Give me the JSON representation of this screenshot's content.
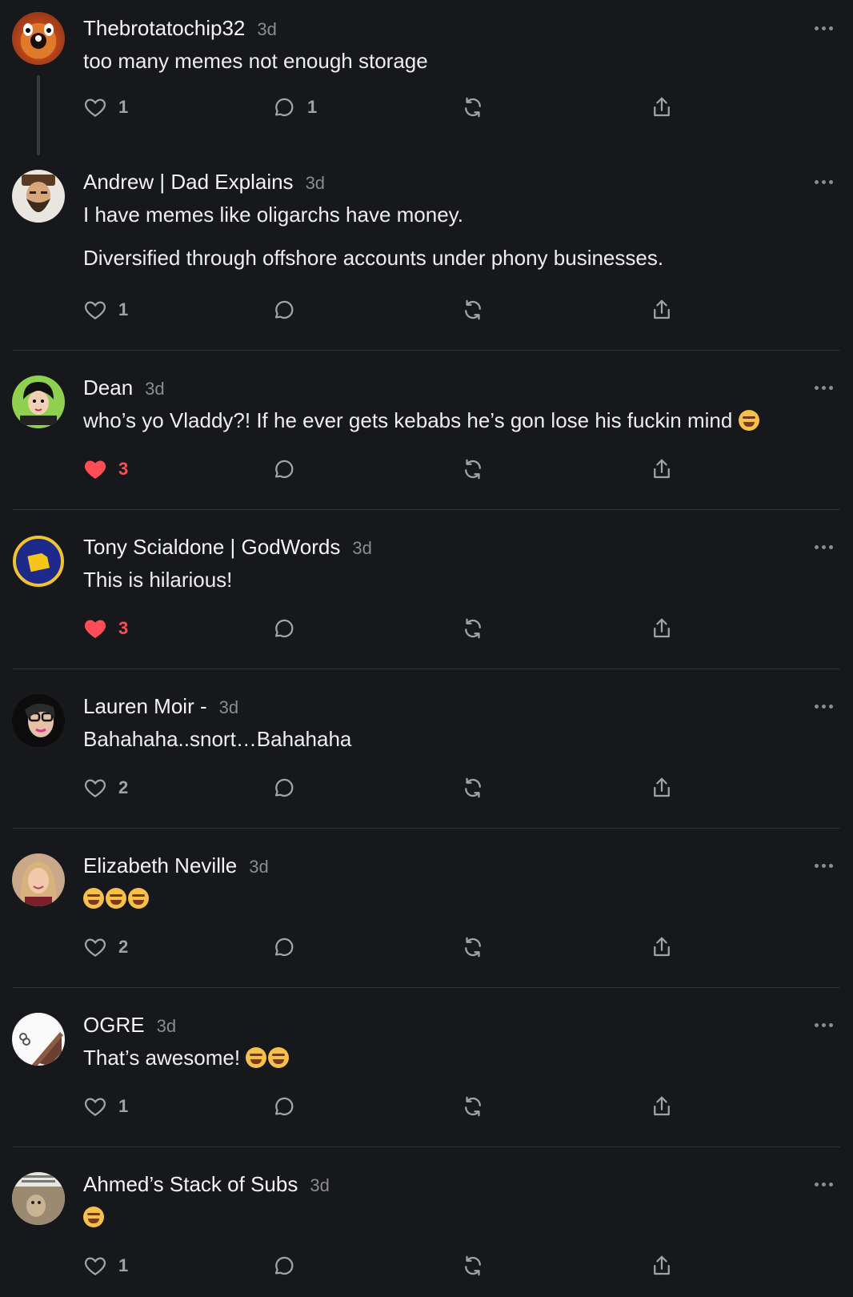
{
  "comments": [
    {
      "name": "Thebrotatochip32",
      "time": "3d",
      "lines": [
        "too many memes not enough storage"
      ],
      "likes": "1",
      "liked": false,
      "replies": "1",
      "avatar": "dog-avatar"
    },
    {
      "name": "Andrew | Dad Explains",
      "time": "3d",
      "lines": [
        "I have memes like oligarchs have money.",
        "Diversified through offshore accounts under phony businesses."
      ],
      "likes": "1",
      "liked": false,
      "replies": "",
      "avatar": "bearded-man-avatar"
    },
    {
      "name": "Dean",
      "time": "3d",
      "lines": [
        "who’s yo Vladdy?! If he ever gets kebabs he’s gon lose his fuckin mind"
      ],
      "emoji": [
        "laughing-tears"
      ],
      "likes": "3",
      "liked": true,
      "replies": "",
      "avatar": "retro-woman-avatar"
    },
    {
      "name": "Tony Scialdone | GodWords",
      "time": "3d",
      "lines": [
        "This is hilarious!"
      ],
      "likes": "3",
      "liked": true,
      "replies": "",
      "avatar": "godwords-logo-avatar"
    },
    {
      "name": "Lauren Moir -",
      "time": "3d",
      "lines": [
        "Bahahaha..snort…Bahahaha"
      ],
      "likes": "2",
      "liked": false,
      "replies": "",
      "avatar": "woman-glasses-avatar"
    },
    {
      "name": "Elizabeth Neville",
      "time": "3d",
      "lines": [
        ""
      ],
      "emoji": [
        "laughing-tears",
        "laughing-tears",
        "laughing-tears"
      ],
      "likes": "2",
      "liked": false,
      "replies": "",
      "avatar": "woman-portrait-avatar"
    },
    {
      "name": "OGRE",
      "time": "3d",
      "lines": [
        "That’s awesome!"
      ],
      "emoji": [
        "rolling-laughing",
        "laughing-tears"
      ],
      "likes": "1",
      "liked": false,
      "replies": "",
      "avatar": "ogre-avatar"
    },
    {
      "name": "Ahmed’s Stack of Subs",
      "time": "3d",
      "lines": [
        ""
      ],
      "emoji": [
        "grinning-sweat"
      ],
      "likes": "1",
      "liked": false,
      "replies": "",
      "avatar": "meme-avatar"
    }
  ],
  "colors": {
    "like_active": "#ff4d57",
    "icon": "#a2a3a8",
    "background": "#17181b"
  },
  "icons": [
    "heart-icon",
    "comment-icon",
    "restack-icon",
    "share-icon",
    "more-icon"
  ]
}
